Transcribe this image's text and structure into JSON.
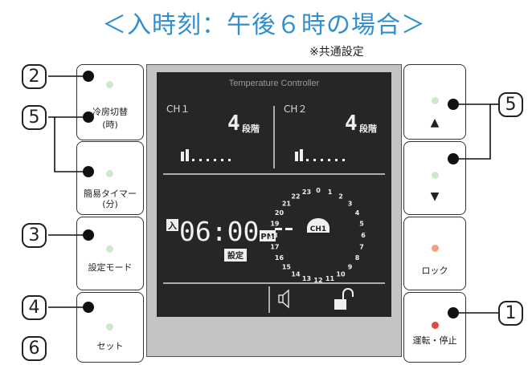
{
  "header": {
    "title": "＜入時刻：午後６時の場合＞",
    "subtitle": "※共通設定"
  },
  "left_buttons": [
    {
      "label": "冷房切替",
      "sub": "(時)"
    },
    {
      "label": "簡易タイマー",
      "sub": "(分)"
    },
    {
      "label": "設定モード"
    },
    {
      "label": "セット"
    }
  ],
  "right_buttons": [
    {
      "symbol": "▲"
    },
    {
      "symbol": "▼"
    },
    {
      "label": "ロック"
    },
    {
      "label": "運転・停止"
    }
  ],
  "display": {
    "title": "Temperature Controller",
    "ch1_label": "CH１",
    "ch2_label": "CH２",
    "ch1_level": "4",
    "ch2_level": "4",
    "level_unit": "段階",
    "on_indicator": "入",
    "time": "06:00",
    "pm": "PM",
    "setting": "設定",
    "dial_channel": "CH1",
    "dial_hours": [
      "0",
      "1",
      "2",
      "3",
      "4",
      "5",
      "6",
      "7",
      "8",
      "9",
      "10",
      "11",
      "12",
      "13",
      "14",
      "15",
      "16",
      "17",
      "18",
      "19",
      "20",
      "21",
      "22",
      "23"
    ],
    "speaker_icon": "speaker-icon",
    "lock_icon": "unlock-icon"
  },
  "callouts": [
    "2",
    "5",
    "3",
    "4",
    "6",
    "5",
    "1"
  ],
  "colors": {
    "title": "#2f8fd0",
    "led_green": "#cde8cd",
    "led_orange": "#f2a07e",
    "led_red": "#e24a35",
    "screen_bg": "#262626",
    "panel_bg": "#c4c4c4"
  }
}
